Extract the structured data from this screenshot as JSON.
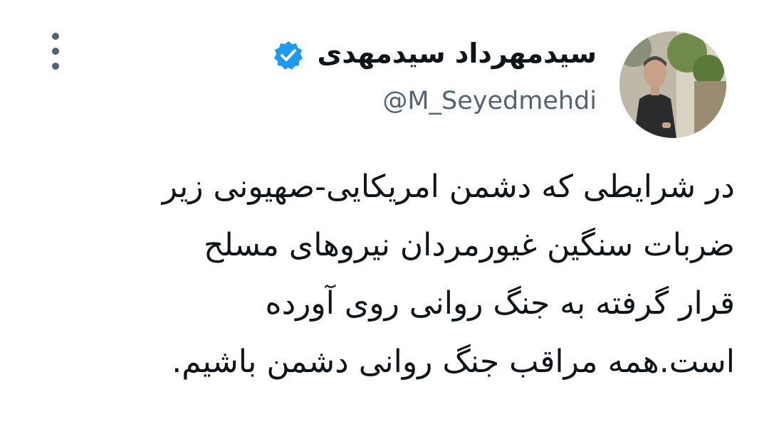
{
  "tweet": {
    "author": {
      "display_name": "سیدمهرداد سیدمهدی",
      "handle": "@M_Seyedmehdi",
      "verified": true,
      "verified_badge_color": "#1d9bf0"
    },
    "text_lines": [
      "در شرایطی که دشمن امریکایی-صهیونی زیر",
      "ضربات سنگین  غیورمردان نیروهای مسلح",
      "قرار گرفته به جنگ روانی روی آورده",
      "است.همه مراقب جنگ روانی دشمن باشیم."
    ],
    "icons": {
      "avatar": "profile-photo",
      "verified": "verified-badge-icon",
      "menu": "more-vertical-icon"
    }
  },
  "colors": {
    "text_primary": "#0f1419",
    "text_secondary": "#536471",
    "accent": "#1d9bf0"
  }
}
